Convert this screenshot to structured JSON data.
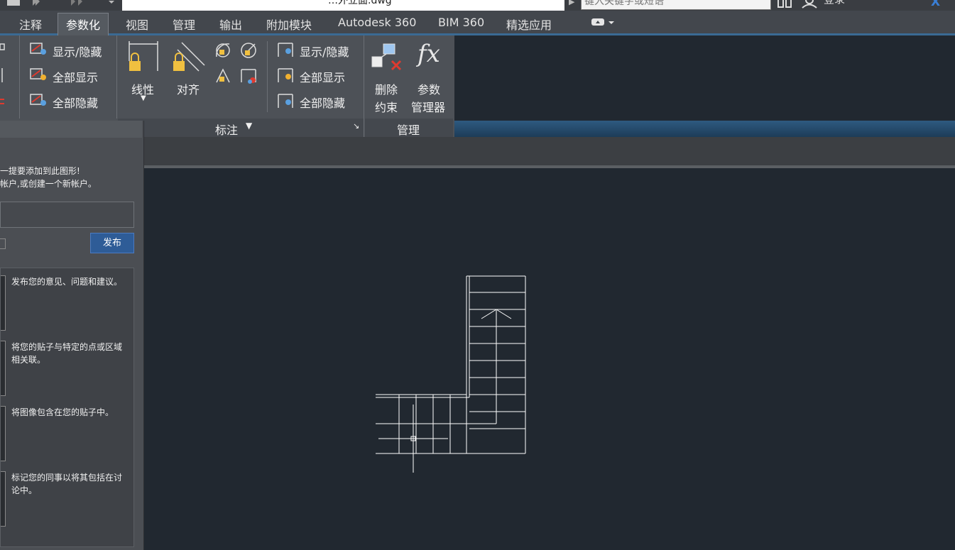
{
  "titlebar": {
    "document_title": "…外立面.dwg",
    "search_placeholder": "键入关键字或短语",
    "login_label": "登录"
  },
  "tabs": [
    {
      "label": "注释",
      "active": false
    },
    {
      "label": "参数化",
      "active": true
    },
    {
      "label": "视图",
      "active": false
    },
    {
      "label": "管理",
      "active": false
    },
    {
      "label": "输出",
      "active": false
    },
    {
      "label": "附加模块",
      "active": false
    },
    {
      "label": "Autodesk 360",
      "active": false
    },
    {
      "label": "BIM 360",
      "active": false
    },
    {
      "label": "精选应用",
      "active": false
    }
  ],
  "ribbon": {
    "geometric": {
      "show_hide": "显示/隐藏",
      "show_all": "全部显示",
      "hide_all": "全部隐藏"
    },
    "dimensional": {
      "linear": "线性",
      "aligned": "对齐",
      "show_hide": "显示/隐藏",
      "show_all": "全部显示",
      "hide_all": "全部隐藏",
      "panel_label": "标注"
    },
    "manage": {
      "delete_line1": "删除",
      "delete_line2": "约束",
      "params_line1": "参数",
      "params_line2": "管理器",
      "panel_label": "管理"
    }
  },
  "palette": {
    "message_line1": "一提要添加到此图形!",
    "message_line2": "帐户,或创建一个新帐户。",
    "publish_button": "发布",
    "items": [
      {
        "text": "发布您的意见、问题和建议。"
      },
      {
        "text": "将您的贴子与特定的点或区域相关联。"
      },
      {
        "text": "将图像包含在您的贴子中。"
      },
      {
        "text": "标记您的同事以将其包括在讨论中。"
      }
    ]
  },
  "icons": {
    "quick_access": "quick-access-icons",
    "fx": "fx-icon",
    "delete_constraint": "delete-constraint-icon"
  },
  "colors": {
    "background": "#212830",
    "ribbon": "#4d5157",
    "accent_blue": "#2e5c97",
    "drawing_lines": "#ffffff"
  }
}
